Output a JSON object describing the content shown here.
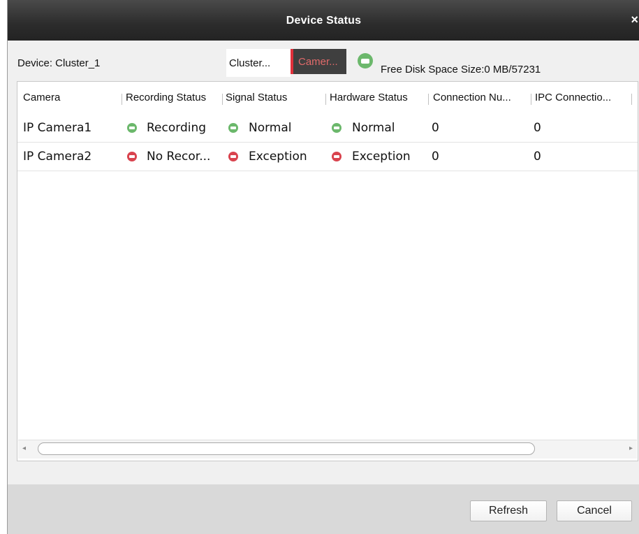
{
  "window": {
    "title": "Device Status",
    "close_glyph": "×"
  },
  "device": {
    "label": "Device: Cluster_1"
  },
  "tabs": [
    {
      "label": "Cluster...",
      "selected": false
    },
    {
      "label": "Camer...",
      "selected": true
    }
  ],
  "disk": {
    "icon": "disk-status-icon",
    "text": "Free Disk Space Size:0 MB/57231"
  },
  "table": {
    "columns": [
      "Camera",
      "Recording Status",
      "Signal Status",
      "Hardware Status",
      "Connection Nu...",
      "IPC Connectio..."
    ],
    "rows": [
      {
        "camera": "IP Camera1",
        "recording": "Recording",
        "recording_state": "ok",
        "signal": "Normal",
        "signal_state": "ok",
        "hardware": "Normal",
        "hardware_state": "ok",
        "connection_num": "0",
        "ipc_connection": "0"
      },
      {
        "camera": "IP Camera2",
        "recording": "No Recor...",
        "recording_state": "error",
        "signal": "Exception",
        "signal_state": "error",
        "hardware": "Exception",
        "hardware_state": "error",
        "connection_num": "0",
        "ipc_connection": "0"
      }
    ]
  },
  "colors": {
    "ok": "#6cb86c",
    "error": "#d9434e",
    "accent": "#e0303a"
  },
  "buttons": {
    "refresh": "Refresh",
    "cancel": "Cancel"
  }
}
